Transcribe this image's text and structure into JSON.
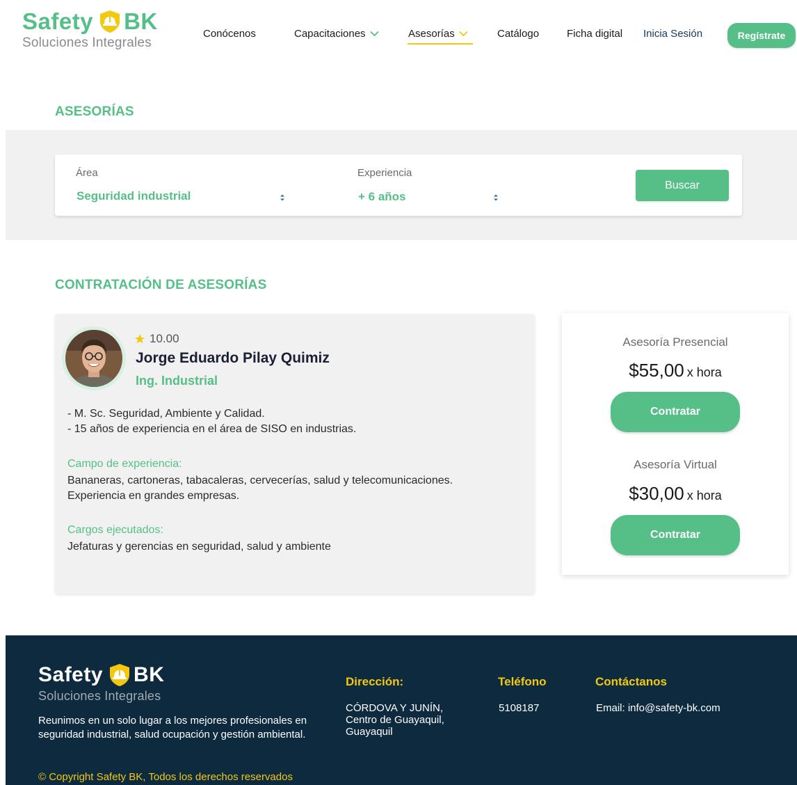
{
  "brand": {
    "name_left": "Safety",
    "name_right": "BK",
    "tagline": "Soluciones Integrales",
    "green": "#55bf87",
    "yellow": "#f2c811",
    "navy": "#0e2a3f"
  },
  "nav": {
    "items": [
      {
        "label": "Conócenos",
        "dropdown": false
      },
      {
        "label": "Capacitaciones",
        "dropdown": true
      },
      {
        "label": "Asesorías",
        "dropdown": true,
        "active": true
      },
      {
        "label": "Catálogo",
        "dropdown": false
      },
      {
        "label": "Ficha digital",
        "dropdown": false
      }
    ],
    "login": "Inicia Sesión",
    "register": "Regístrate"
  },
  "search": {
    "section_title": "ASESORÍAS",
    "area_label": "Área",
    "area_value": "Seguridad industrial",
    "experience_label": "Experiencia",
    "experience_value": "+ 6 años",
    "button": "Buscar"
  },
  "hiring": {
    "section_title": "CONTRATACIÓN DE ASESORÍAS",
    "advisor": {
      "avatar_icon": "person-photo",
      "rating": "10.00",
      "name": "Jorge Eduardo Pilay Quimiz",
      "title": "Ing. Industrial",
      "bio_lines": [
        "- M. Sc. Seguridad, Ambiente y Calidad.",
        "- 15 años de experiencia en el área de SISO en industrias."
      ],
      "field_label": "Campo de experiencia:",
      "field_lines": [
        "Bananeras, cartoneras, tabacaleras, cervecerías, salud y telecomunicaciones.",
        "Experiencia en grandes empresas."
      ],
      "positions_label": "Cargos ejecutados:",
      "positions_text": "Jefaturas y gerencias en seguridad, salud y ambiente"
    },
    "pricing": [
      {
        "label": "Asesoría Presencial",
        "price": "$55,00",
        "unit": "x hora",
        "button": "Contratar"
      },
      {
        "label": "Asesoría Virtual",
        "price": "$30,00",
        "unit": "x hora",
        "button": "Contratar"
      }
    ]
  },
  "footer": {
    "description": "Reunimos en un solo lugar a los mejores profesionales en seguridad industrial, salud ocupación y gestión ambiental.",
    "copyright": "© Copyright Safety BK,  Todos los derechos reservados",
    "address_head": "Dirección:",
    "address_lines": [
      "CÓRDOVA Y JUNÍN,",
      "Centro de Guayaquil,",
      "Guayaquil"
    ],
    "phone_head": "Teléfono",
    "phone": "5108187",
    "contact_head": "Contáctanos",
    "email": "Email: info@safety-bk.com"
  }
}
